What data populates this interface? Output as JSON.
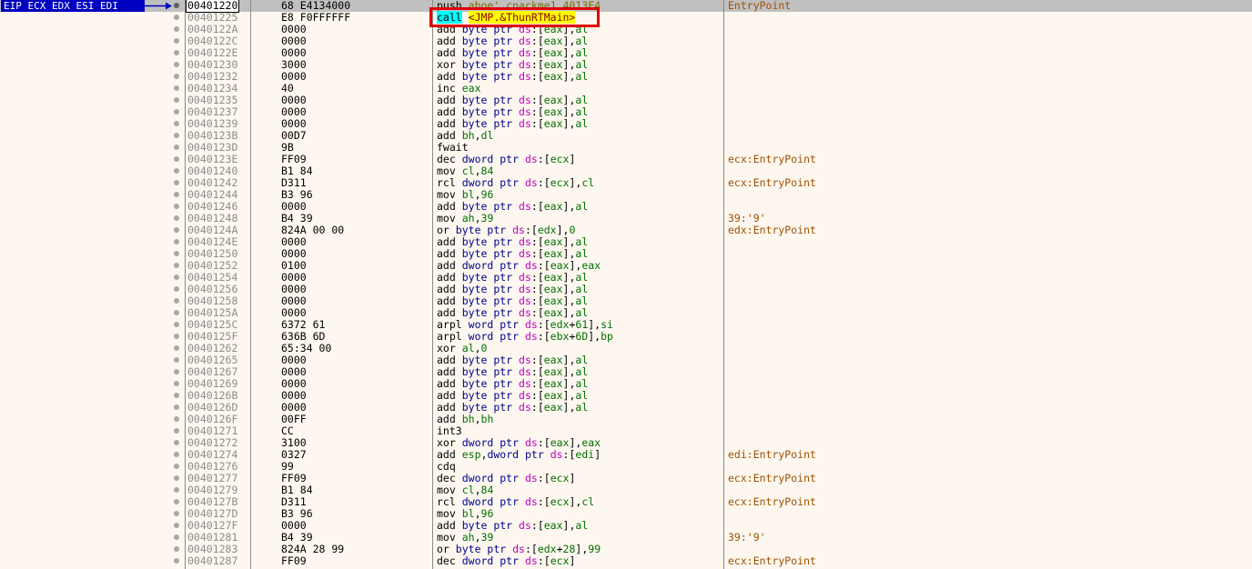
{
  "registers_label": "EIP ECX EDX ESI EDI",
  "rows": [
    {
      "addr": "00401220",
      "bytes": "68 E4134000",
      "mn": "push",
      "ops": [
        [
          "plain",
          "aboe' cnackme1.4013E4"
        ]
      ],
      "cmt": "EntryPoint"
    },
    {
      "addr": "00401225",
      "bytes": "E8 F0FFFFFF",
      "mn": "call",
      "ops": [
        [
          "tgt",
          "<JMP.&ThunRTMain>"
        ]
      ],
      "cmt": ""
    },
    {
      "addr": "0040122A",
      "bytes": "0000",
      "mn": "add",
      "ops": [
        [
          "sz",
          "byte ptr "
        ],
        [
          "seg",
          "ds"
        ],
        [
          "p",
          ":["
        ],
        [
          "reg",
          "eax"
        ],
        [
          "p",
          "],"
        ],
        [
          "reg",
          "al"
        ]
      ],
      "cmt": ""
    },
    {
      "addr": "0040122C",
      "bytes": "0000",
      "mn": "add",
      "ops": [
        [
          "sz",
          "byte ptr "
        ],
        [
          "seg",
          "ds"
        ],
        [
          "p",
          ":["
        ],
        [
          "reg",
          "eax"
        ],
        [
          "p",
          "],"
        ],
        [
          "reg",
          "al"
        ]
      ],
      "cmt": ""
    },
    {
      "addr": "0040122E",
      "bytes": "0000",
      "mn": "add",
      "ops": [
        [
          "sz",
          "byte ptr "
        ],
        [
          "seg",
          "ds"
        ],
        [
          "p",
          ":["
        ],
        [
          "reg",
          "eax"
        ],
        [
          "p",
          "],"
        ],
        [
          "reg",
          "al"
        ]
      ],
      "cmt": ""
    },
    {
      "addr": "00401230",
      "bytes": "3000",
      "mn": "xor",
      "ops": [
        [
          "sz",
          "byte ptr "
        ],
        [
          "seg",
          "ds"
        ],
        [
          "p",
          ":["
        ],
        [
          "reg",
          "eax"
        ],
        [
          "p",
          "],"
        ],
        [
          "reg",
          "al"
        ]
      ],
      "cmt": ""
    },
    {
      "addr": "00401232",
      "bytes": "0000",
      "mn": "add",
      "ops": [
        [
          "sz",
          "byte ptr "
        ],
        [
          "seg",
          "ds"
        ],
        [
          "p",
          ":["
        ],
        [
          "reg",
          "eax"
        ],
        [
          "p",
          "],"
        ],
        [
          "reg",
          "al"
        ]
      ],
      "cmt": ""
    },
    {
      "addr": "00401234",
      "bytes": "40",
      "mn": "inc",
      "ops": [
        [
          "reg",
          "eax"
        ]
      ],
      "cmt": ""
    },
    {
      "addr": "00401235",
      "bytes": "0000",
      "mn": "add",
      "ops": [
        [
          "sz",
          "byte ptr "
        ],
        [
          "seg",
          "ds"
        ],
        [
          "p",
          ":["
        ],
        [
          "reg",
          "eax"
        ],
        [
          "p",
          "],"
        ],
        [
          "reg",
          "al"
        ]
      ],
      "cmt": ""
    },
    {
      "addr": "00401237",
      "bytes": "0000",
      "mn": "add",
      "ops": [
        [
          "sz",
          "byte ptr "
        ],
        [
          "seg",
          "ds"
        ],
        [
          "p",
          ":["
        ],
        [
          "reg",
          "eax"
        ],
        [
          "p",
          "],"
        ],
        [
          "reg",
          "al"
        ]
      ],
      "cmt": ""
    },
    {
      "addr": "00401239",
      "bytes": "0000",
      "mn": "add",
      "ops": [
        [
          "sz",
          "byte ptr "
        ],
        [
          "seg",
          "ds"
        ],
        [
          "p",
          ":["
        ],
        [
          "reg",
          "eax"
        ],
        [
          "p",
          "],"
        ],
        [
          "reg",
          "al"
        ]
      ],
      "cmt": ""
    },
    {
      "addr": "0040123B",
      "bytes": "00D7",
      "mn": "add",
      "ops": [
        [
          "reg",
          "bh"
        ],
        [
          "p",
          ","
        ],
        [
          "reg",
          "dl"
        ]
      ],
      "cmt": ""
    },
    {
      "addr": "0040123D",
      "bytes": "9B",
      "mn": "fwait",
      "ops": [],
      "cmt": ""
    },
    {
      "addr": "0040123E",
      "bytes": "FF09",
      "mn": "dec",
      "ops": [
        [
          "sz",
          "dword ptr "
        ],
        [
          "seg",
          "ds"
        ],
        [
          "p",
          ":["
        ],
        [
          "reg",
          "ecx"
        ],
        [
          "p",
          "]"
        ]
      ],
      "cmt": "ecx:EntryPoint"
    },
    {
      "addr": "00401240",
      "bytes": "B1 84",
      "mn": "mov",
      "ops": [
        [
          "reg",
          "cl"
        ],
        [
          "p",
          ","
        ],
        [
          "num",
          "84"
        ]
      ],
      "cmt": ""
    },
    {
      "addr": "00401242",
      "bytes": "D311",
      "mn": "rcl",
      "ops": [
        [
          "sz",
          "dword ptr "
        ],
        [
          "seg",
          "ds"
        ],
        [
          "p",
          ":["
        ],
        [
          "reg",
          "ecx"
        ],
        [
          "p",
          "],"
        ],
        [
          "reg",
          "cl"
        ]
      ],
      "cmt": "ecx:EntryPoint"
    },
    {
      "addr": "00401244",
      "bytes": "B3 96",
      "mn": "mov",
      "ops": [
        [
          "reg",
          "bl"
        ],
        [
          "p",
          ","
        ],
        [
          "num",
          "96"
        ]
      ],
      "cmt": ""
    },
    {
      "addr": "00401246",
      "bytes": "0000",
      "mn": "add",
      "ops": [
        [
          "sz",
          "byte ptr "
        ],
        [
          "seg",
          "ds"
        ],
        [
          "p",
          ":["
        ],
        [
          "reg",
          "eax"
        ],
        [
          "p",
          "],"
        ],
        [
          "reg",
          "al"
        ]
      ],
      "cmt": ""
    },
    {
      "addr": "00401248",
      "bytes": "B4 39",
      "mn": "mov",
      "ops": [
        [
          "reg",
          "ah"
        ],
        [
          "p",
          ","
        ],
        [
          "num",
          "39"
        ]
      ],
      "cmt": "39:'9'"
    },
    {
      "addr": "0040124A",
      "bytes": "824A 00 00",
      "mn": "or",
      "ops": [
        [
          "sz",
          "byte ptr "
        ],
        [
          "seg",
          "ds"
        ],
        [
          "p",
          ":["
        ],
        [
          "reg",
          "edx"
        ],
        [
          "p",
          "],"
        ],
        [
          "num",
          "0"
        ]
      ],
      "cmt": "edx:EntryPoint"
    },
    {
      "addr": "0040124E",
      "bytes": "0000",
      "mn": "add",
      "ops": [
        [
          "sz",
          "byte ptr "
        ],
        [
          "seg",
          "ds"
        ],
        [
          "p",
          ":["
        ],
        [
          "reg",
          "eax"
        ],
        [
          "p",
          "],"
        ],
        [
          "reg",
          "al"
        ]
      ],
      "cmt": ""
    },
    {
      "addr": "00401250",
      "bytes": "0000",
      "mn": "add",
      "ops": [
        [
          "sz",
          "byte ptr "
        ],
        [
          "seg",
          "ds"
        ],
        [
          "p",
          ":["
        ],
        [
          "reg",
          "eax"
        ],
        [
          "p",
          "],"
        ],
        [
          "reg",
          "al"
        ]
      ],
      "cmt": ""
    },
    {
      "addr": "00401252",
      "bytes": "0100",
      "mn": "add",
      "ops": [
        [
          "sz",
          "dword ptr "
        ],
        [
          "seg",
          "ds"
        ],
        [
          "p",
          ":["
        ],
        [
          "reg",
          "eax"
        ],
        [
          "p",
          "],"
        ],
        [
          "reg",
          "eax"
        ]
      ],
      "cmt": ""
    },
    {
      "addr": "00401254",
      "bytes": "0000",
      "mn": "add",
      "ops": [
        [
          "sz",
          "byte ptr "
        ],
        [
          "seg",
          "ds"
        ],
        [
          "p",
          ":["
        ],
        [
          "reg",
          "eax"
        ],
        [
          "p",
          "],"
        ],
        [
          "reg",
          "al"
        ]
      ],
      "cmt": ""
    },
    {
      "addr": "00401256",
      "bytes": "0000",
      "mn": "add",
      "ops": [
        [
          "sz",
          "byte ptr "
        ],
        [
          "seg",
          "ds"
        ],
        [
          "p",
          ":["
        ],
        [
          "reg",
          "eax"
        ],
        [
          "p",
          "],"
        ],
        [
          "reg",
          "al"
        ]
      ],
      "cmt": ""
    },
    {
      "addr": "00401258",
      "bytes": "0000",
      "mn": "add",
      "ops": [
        [
          "sz",
          "byte ptr "
        ],
        [
          "seg",
          "ds"
        ],
        [
          "p",
          ":["
        ],
        [
          "reg",
          "eax"
        ],
        [
          "p",
          "],"
        ],
        [
          "reg",
          "al"
        ]
      ],
      "cmt": ""
    },
    {
      "addr": "0040125A",
      "bytes": "0000",
      "mn": "add",
      "ops": [
        [
          "sz",
          "byte ptr "
        ],
        [
          "seg",
          "ds"
        ],
        [
          "p",
          ":["
        ],
        [
          "reg",
          "eax"
        ],
        [
          "p",
          "],"
        ],
        [
          "reg",
          "al"
        ]
      ],
      "cmt": ""
    },
    {
      "addr": "0040125C",
      "bytes": "6372 61",
      "mn": "arpl",
      "ops": [
        [
          "sz",
          "word ptr "
        ],
        [
          "seg",
          "ds"
        ],
        [
          "p",
          ":["
        ],
        [
          "reg",
          "edx"
        ],
        [
          "p",
          "+"
        ],
        [
          "num",
          "61"
        ],
        [
          "p",
          "],"
        ],
        [
          "reg",
          "si"
        ]
      ],
      "cmt": ""
    },
    {
      "addr": "0040125F",
      "bytes": "636B 6D",
      "mn": "arpl",
      "ops": [
        [
          "sz",
          "word ptr "
        ],
        [
          "seg",
          "ds"
        ],
        [
          "p",
          ":["
        ],
        [
          "reg",
          "ebx"
        ],
        [
          "p",
          "+"
        ],
        [
          "num",
          "6D"
        ],
        [
          "p",
          "],"
        ],
        [
          "reg",
          "bp"
        ]
      ],
      "cmt": ""
    },
    {
      "addr": "00401262",
      "bytes": "65:34 00",
      "mn": "xor",
      "ops": [
        [
          "reg",
          "al"
        ],
        [
          "p",
          ","
        ],
        [
          "num",
          "0"
        ]
      ],
      "cmt": ""
    },
    {
      "addr": "00401265",
      "bytes": "0000",
      "mn": "add",
      "ops": [
        [
          "sz",
          "byte ptr "
        ],
        [
          "seg",
          "ds"
        ],
        [
          "p",
          ":["
        ],
        [
          "reg",
          "eax"
        ],
        [
          "p",
          "],"
        ],
        [
          "reg",
          "al"
        ]
      ],
      "cmt": ""
    },
    {
      "addr": "00401267",
      "bytes": "0000",
      "mn": "add",
      "ops": [
        [
          "sz",
          "byte ptr "
        ],
        [
          "seg",
          "ds"
        ],
        [
          "p",
          ":["
        ],
        [
          "reg",
          "eax"
        ],
        [
          "p",
          "],"
        ],
        [
          "reg",
          "al"
        ]
      ],
      "cmt": ""
    },
    {
      "addr": "00401269",
      "bytes": "0000",
      "mn": "add",
      "ops": [
        [
          "sz",
          "byte ptr "
        ],
        [
          "seg",
          "ds"
        ],
        [
          "p",
          ":["
        ],
        [
          "reg",
          "eax"
        ],
        [
          "p",
          "],"
        ],
        [
          "reg",
          "al"
        ]
      ],
      "cmt": ""
    },
    {
      "addr": "0040126B",
      "bytes": "0000",
      "mn": "add",
      "ops": [
        [
          "sz",
          "byte ptr "
        ],
        [
          "seg",
          "ds"
        ],
        [
          "p",
          ":["
        ],
        [
          "reg",
          "eax"
        ],
        [
          "p",
          "],"
        ],
        [
          "reg",
          "al"
        ]
      ],
      "cmt": ""
    },
    {
      "addr": "0040126D",
      "bytes": "0000",
      "mn": "add",
      "ops": [
        [
          "sz",
          "byte ptr "
        ],
        [
          "seg",
          "ds"
        ],
        [
          "p",
          ":["
        ],
        [
          "reg",
          "eax"
        ],
        [
          "p",
          "],"
        ],
        [
          "reg",
          "al"
        ]
      ],
      "cmt": ""
    },
    {
      "addr": "0040126F",
      "bytes": "00FF",
      "mn": "add",
      "ops": [
        [
          "reg",
          "bh"
        ],
        [
          "p",
          ","
        ],
        [
          "reg",
          "bh"
        ]
      ],
      "cmt": ""
    },
    {
      "addr": "00401271",
      "bytes": "CC",
      "mn": "int3",
      "ops": [],
      "cmt": ""
    },
    {
      "addr": "00401272",
      "bytes": "3100",
      "mn": "xor",
      "ops": [
        [
          "sz",
          "dword ptr "
        ],
        [
          "seg",
          "ds"
        ],
        [
          "p",
          ":["
        ],
        [
          "reg",
          "eax"
        ],
        [
          "p",
          "],"
        ],
        [
          "reg",
          "eax"
        ]
      ],
      "cmt": ""
    },
    {
      "addr": "00401274",
      "bytes": "0327",
      "mn": "add",
      "ops": [
        [
          "reg",
          "esp"
        ],
        [
          "p",
          ","
        ],
        [
          "sz",
          "dword ptr "
        ],
        [
          "seg",
          "ds"
        ],
        [
          "p",
          ":["
        ],
        [
          "reg",
          "edi"
        ],
        [
          "p",
          "]"
        ]
      ],
      "cmt": "edi:EntryPoint"
    },
    {
      "addr": "00401276",
      "bytes": "99",
      "mn": "cdq",
      "ops": [],
      "cmt": ""
    },
    {
      "addr": "00401277",
      "bytes": "FF09",
      "mn": "dec",
      "ops": [
        [
          "sz",
          "dword ptr "
        ],
        [
          "seg",
          "ds"
        ],
        [
          "p",
          ":["
        ],
        [
          "reg",
          "ecx"
        ],
        [
          "p",
          "]"
        ]
      ],
      "cmt": "ecx:EntryPoint"
    },
    {
      "addr": "00401279",
      "bytes": "B1 84",
      "mn": "mov",
      "ops": [
        [
          "reg",
          "cl"
        ],
        [
          "p",
          ","
        ],
        [
          "num",
          "84"
        ]
      ],
      "cmt": ""
    },
    {
      "addr": "0040127B",
      "bytes": "D311",
      "mn": "rcl",
      "ops": [
        [
          "sz",
          "dword ptr "
        ],
        [
          "seg",
          "ds"
        ],
        [
          "p",
          ":["
        ],
        [
          "reg",
          "ecx"
        ],
        [
          "p",
          "],"
        ],
        [
          "reg",
          "cl"
        ]
      ],
      "cmt": "ecx:EntryPoint"
    },
    {
      "addr": "0040127D",
      "bytes": "B3 96",
      "mn": "mov",
      "ops": [
        [
          "reg",
          "bl"
        ],
        [
          "p",
          ","
        ],
        [
          "num",
          "96"
        ]
      ],
      "cmt": ""
    },
    {
      "addr": "0040127F",
      "bytes": "0000",
      "mn": "add",
      "ops": [
        [
          "sz",
          "byte ptr "
        ],
        [
          "seg",
          "ds"
        ],
        [
          "p",
          ":["
        ],
        [
          "reg",
          "eax"
        ],
        [
          "p",
          "],"
        ],
        [
          "reg",
          "al"
        ]
      ],
      "cmt": ""
    },
    {
      "addr": "00401281",
      "bytes": "B4 39",
      "mn": "mov",
      "ops": [
        [
          "reg",
          "ah"
        ],
        [
          "p",
          ","
        ],
        [
          "num",
          "39"
        ]
      ],
      "cmt": "39:'9'"
    },
    {
      "addr": "00401283",
      "bytes": "824A 28 99",
      "mn": "or",
      "ops": [
        [
          "sz",
          "byte ptr "
        ],
        [
          "seg",
          "ds"
        ],
        [
          "p",
          ":["
        ],
        [
          "reg",
          "edx"
        ],
        [
          "p",
          "+"
        ],
        [
          "num",
          "28"
        ],
        [
          "p",
          "],"
        ],
        [
          "num",
          "99"
        ]
      ],
      "cmt": ""
    },
    {
      "addr": "00401287",
      "bytes": "FF09",
      "mn": "dec",
      "ops": [
        [
          "sz",
          "dword ptr "
        ],
        [
          "seg",
          "ds"
        ],
        [
          "p",
          ":["
        ],
        [
          "reg",
          "ecx"
        ],
        [
          "p",
          "]"
        ]
      ],
      "cmt": "ecx:EntryPoint"
    }
  ]
}
